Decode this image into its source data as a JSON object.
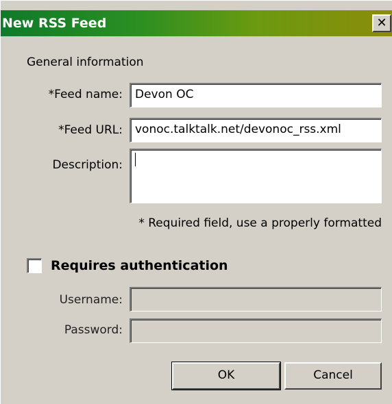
{
  "window": {
    "title": "New RSS Feed",
    "close_glyph": "✕"
  },
  "form": {
    "section_label": "General information",
    "feed_name_label": "*Feed name:",
    "feed_name_value": "Devon OC",
    "feed_url_label": "*Feed URL:",
    "feed_url_value": "vonoc.talktalk.net/devonoc_rss.xml",
    "description_label": "Description:",
    "description_value": "",
    "required_note": "* Required field, use a properly formatted"
  },
  "auth": {
    "checkbox_label": "Requires authentication",
    "checked": false,
    "username_label": "Username:",
    "username_value": "",
    "password_label": "Password:",
    "password_value": ""
  },
  "buttons": {
    "ok": "OK",
    "cancel": "Cancel"
  },
  "colors": {
    "title_gradient_start": "#0f7a2a",
    "title_gradient_end": "#8c8c0a",
    "dialog_background": "#d4d0c8"
  }
}
